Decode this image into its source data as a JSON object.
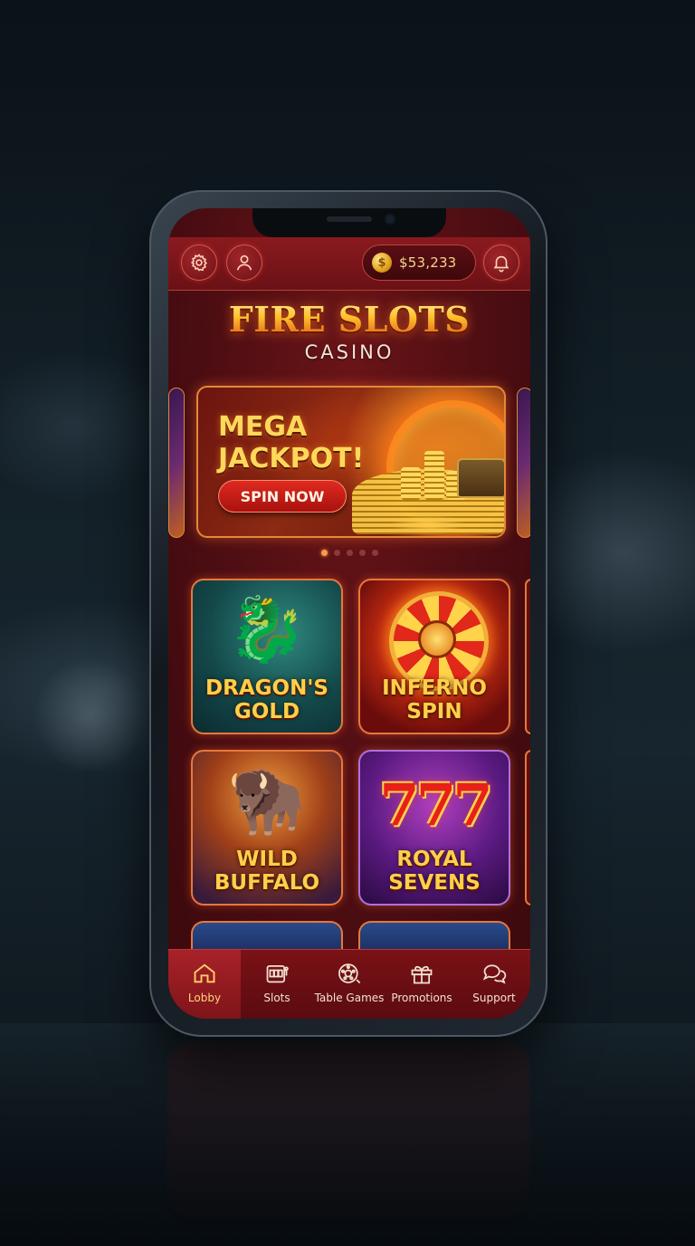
{
  "header": {
    "balance": "$53,233",
    "coin_symbol": "$"
  },
  "brand": {
    "title": "FIRE SLOTS",
    "subtitle": "CASINO"
  },
  "banner": {
    "title_line1": "MEGA",
    "title_line2": "JACKPOT!",
    "cta": "SPIN NOW",
    "slide_count": 5,
    "active_slide": 1
  },
  "games": [
    {
      "title_line1": "DRAGON'S",
      "title_line2": "GOLD",
      "icon": "dragon-icon"
    },
    {
      "title_line1": "INFERNO",
      "title_line2": "SPIN",
      "icon": "wheel-icon"
    },
    {
      "title_line1": "WILD",
      "title_line2": "BUFFALO",
      "icon": "buffalo-icon"
    },
    {
      "title_line1": "ROYAL",
      "title_line2": "SEVENS",
      "icon": "sevens-icon"
    }
  ],
  "sevens_text": "777",
  "nav": [
    {
      "label": "Lobby",
      "icon": "home-icon",
      "active": true
    },
    {
      "label": "Slots",
      "icon": "slot-machine-icon",
      "active": false
    },
    {
      "label": "Table Games",
      "icon": "roulette-icon",
      "active": false
    },
    {
      "label": "Promotions",
      "icon": "gift-icon",
      "active": false
    },
    {
      "label": "Support",
      "icon": "chat-icon",
      "active": false
    }
  ],
  "colors": {
    "accent_gold": "#ffcf4a",
    "screen_red": "#4a0d12",
    "border_orange": "#e6783a",
    "active_nav": "#a82228"
  }
}
